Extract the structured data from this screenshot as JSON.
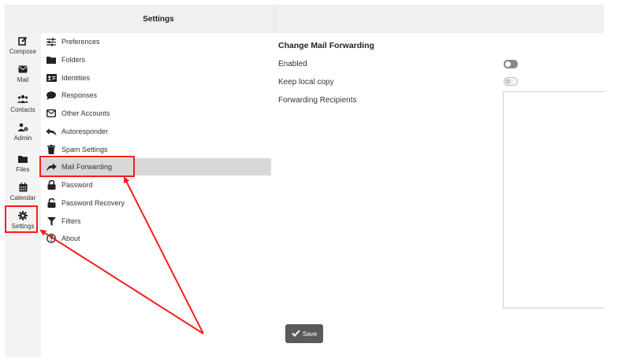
{
  "header": {
    "title": "Settings"
  },
  "nav": {
    "items": [
      {
        "label": "Compose",
        "icon": "compose-icon"
      },
      {
        "label": "Mail",
        "icon": "mail-icon"
      },
      {
        "label": "Contacts",
        "icon": "contacts-icon"
      },
      {
        "label": "Admin",
        "icon": "admin-icon"
      },
      {
        "label": "Files",
        "icon": "folder-icon"
      },
      {
        "label": "Calendar",
        "icon": "calendar-icon"
      },
      {
        "label": "Settings",
        "icon": "gear-icon"
      }
    ]
  },
  "settings_list": {
    "items": [
      {
        "label": "Preferences",
        "icon": "sliders-icon"
      },
      {
        "label": "Folders",
        "icon": "folder-icon"
      },
      {
        "label": "Identities",
        "icon": "id-card-icon"
      },
      {
        "label": "Responses",
        "icon": "comment-icon"
      },
      {
        "label": "Other Accounts",
        "icon": "envelope-icon"
      },
      {
        "label": "Autoresponder",
        "icon": "reply-all-icon"
      },
      {
        "label": "Spam Settings",
        "icon": "trash-icon"
      },
      {
        "label": "Mail Forwarding",
        "icon": "share-icon"
      },
      {
        "label": "Password",
        "icon": "lock-icon"
      },
      {
        "label": "Password Recovery",
        "icon": "unlock-icon"
      },
      {
        "label": "Filters",
        "icon": "filter-icon"
      },
      {
        "label": "About",
        "icon": "question-circle-icon"
      }
    ],
    "active": "Mail Forwarding"
  },
  "forwarding": {
    "heading": "Change Mail Forwarding",
    "enabled_label": "Enabled",
    "enabled": true,
    "keep_copy_label": "Keep local copy",
    "keep_copy": false,
    "recipients_label": "Forwarding Recipients",
    "recipients_value": "",
    "save_label": "Save"
  },
  "colors": {
    "highlight": "#ff1a1a",
    "active_row": "#d8d8d8",
    "save_button": "#5a5a5a"
  }
}
